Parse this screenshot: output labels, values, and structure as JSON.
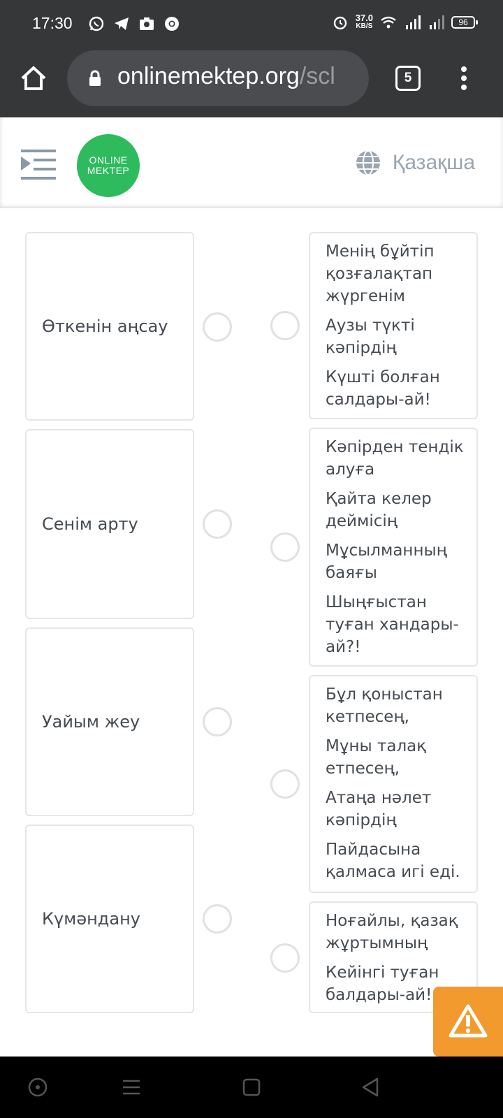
{
  "status": {
    "time": "17:30",
    "net_speed": "37.0",
    "net_unit": "KB/S",
    "battery": "96"
  },
  "browser": {
    "url_main": "onlinemektep.org",
    "url_dim": "/scl",
    "tab_count": "5"
  },
  "header": {
    "logo_line1": "ONLINE",
    "logo_line2": "MEKTEP",
    "language": "Қазақша"
  },
  "left_items": [
    "Өткенін аңсау",
    "Сенім арту",
    "Уайым жеу",
    "Күмәндану"
  ],
  "right_items": [
    [
      "Менің бұйтіп қозғалақтап жүргенім",
      "Аузы түкті кәпірдің",
      "Күшті болған салдары-ай!"
    ],
    [
      "Кәпірден тендік алуға",
      "Қайта келер деймісің",
      "Мұсылманның баяғы",
      "Шыңғыстан туған хандары-ай?!"
    ],
    [
      "Бұл қоныстан кетпесең,",
      "Мұны талақ етпесең,",
      "Атаңа нәлет кәпірдің",
      "Пайдасына қалмаса игі еді."
    ],
    [
      "Ноғайлы, қазақ жұртымның",
      "Кейінгі туған балдары-ай!"
    ]
  ],
  "colors": {
    "chrome": "#353739",
    "logo_green": "#2dbb5d",
    "warning_orange": "#f29a2e",
    "text": "#454b51"
  }
}
